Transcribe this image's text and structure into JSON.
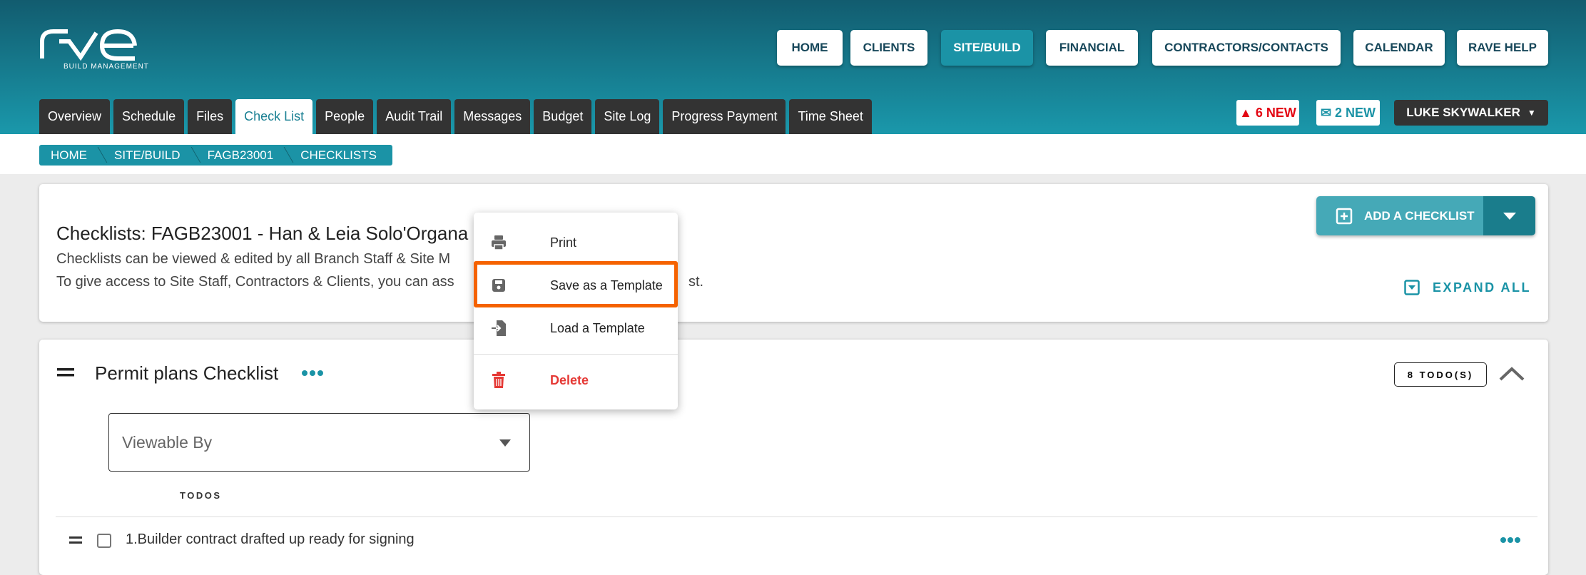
{
  "logo": {
    "text": "rave",
    "subtitle": "BUILD MANAGEMENT"
  },
  "nav": [
    {
      "label": "HOME"
    },
    {
      "label": "CLIENTS"
    },
    {
      "label": "SITE/BUILD",
      "active": true
    },
    {
      "label": "FINANCIAL"
    },
    {
      "label": "CONTRACTORS/CONTACTS"
    },
    {
      "label": "CALENDAR"
    },
    {
      "label": "RAVE HELP"
    }
  ],
  "tabs": [
    {
      "label": "Overview"
    },
    {
      "label": "Schedule"
    },
    {
      "label": "Files"
    },
    {
      "label": "Check List",
      "active": true
    },
    {
      "label": "People"
    },
    {
      "label": "Audit Trail"
    },
    {
      "label": "Messages"
    },
    {
      "label": "Budget"
    },
    {
      "label": "Site Log"
    },
    {
      "label": "Progress Payment"
    },
    {
      "label": "Time Sheet"
    }
  ],
  "alerts": {
    "warnings": "6 NEW",
    "messages": "2 NEW"
  },
  "user": {
    "name": "LUKE SKYWALKER"
  },
  "breadcrumb": [
    "HOME",
    "SITE/BUILD",
    "FAGB23001",
    "CHECKLISTS"
  ],
  "header_card": {
    "title": "Checklists: FAGB23001 - Han & Leia Solo'Organa",
    "desc1": "Checklists can be viewed & edited by all Branch Staff & Site M",
    "desc2": "To give access to Site Staff, Contractors & Clients, you can ass",
    "desc2_tail": "st.",
    "add_button": "ADD A CHECKLIST",
    "expand_all": "EXPAND ALL"
  },
  "checklist": {
    "title": "Permit plans Checklist",
    "todo_count": "8 TODO(S)",
    "viewable_placeholder": "Viewable By",
    "todos_header": "TODOS",
    "items": [
      "1.Builder contract drafted up ready for signing"
    ]
  },
  "menu": {
    "items": [
      {
        "label": "Print"
      },
      {
        "label": "Save as a Template",
        "highlighted": true
      },
      {
        "label": "Load a Template"
      },
      {
        "label": "Delete",
        "danger": true
      }
    ]
  },
  "colors": {
    "teal": "#1b93a6",
    "highlight": "#f56200",
    "danger": "#e53935"
  }
}
